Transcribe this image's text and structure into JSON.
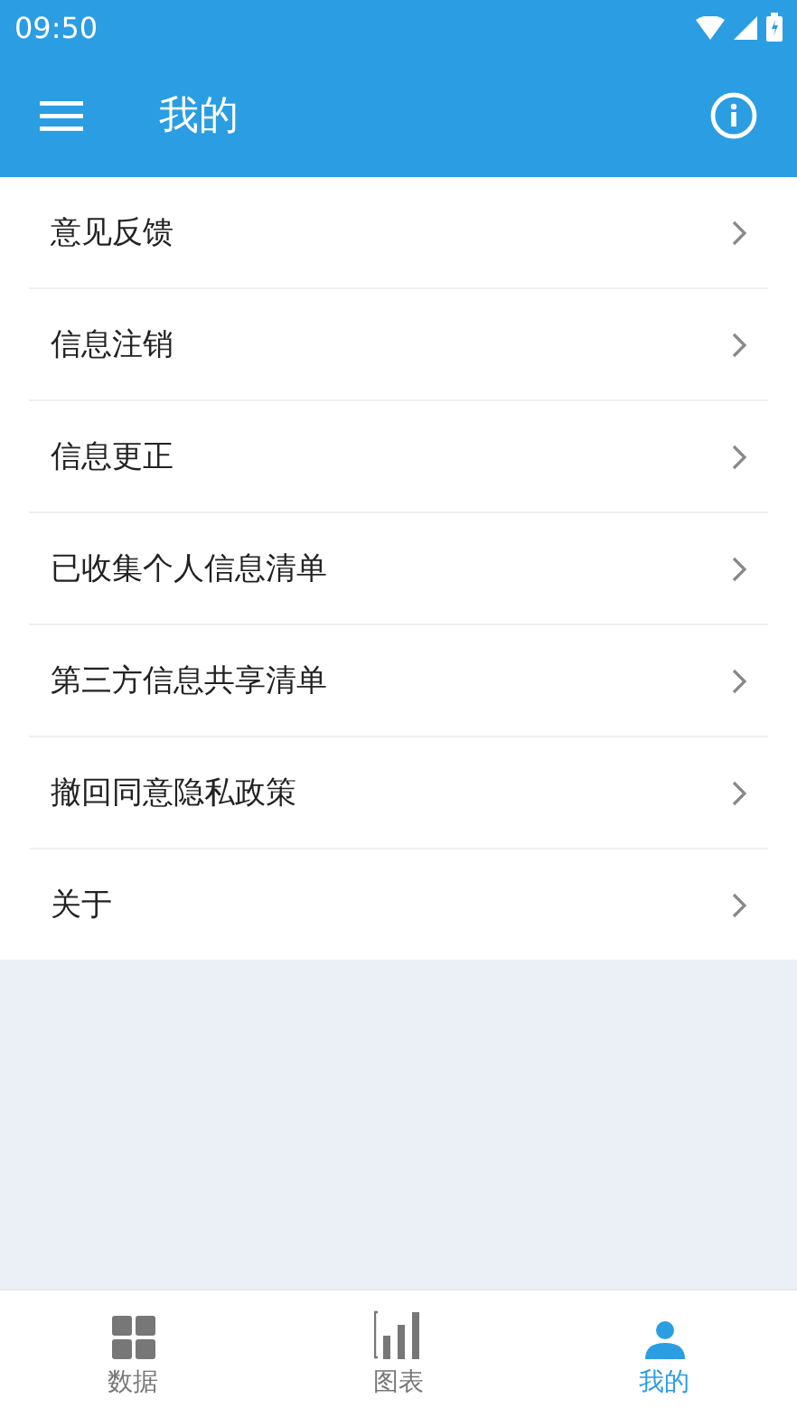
{
  "status_bar": {
    "time": "09:50"
  },
  "app_bar": {
    "title": "我的"
  },
  "menu_items": [
    {
      "label": "意见反馈"
    },
    {
      "label": "信息注销"
    },
    {
      "label": "信息更正"
    },
    {
      "label": "已收集个人信息清单"
    },
    {
      "label": "第三方信息共享清单"
    },
    {
      "label": "撤回同意隐私政策"
    },
    {
      "label": "关于"
    }
  ],
  "bottom_nav": [
    {
      "label": "数据",
      "kind": "grid",
      "selected": false
    },
    {
      "label": "图表",
      "kind": "chart",
      "selected": false
    },
    {
      "label": "我的",
      "kind": "person",
      "selected": true
    }
  ]
}
